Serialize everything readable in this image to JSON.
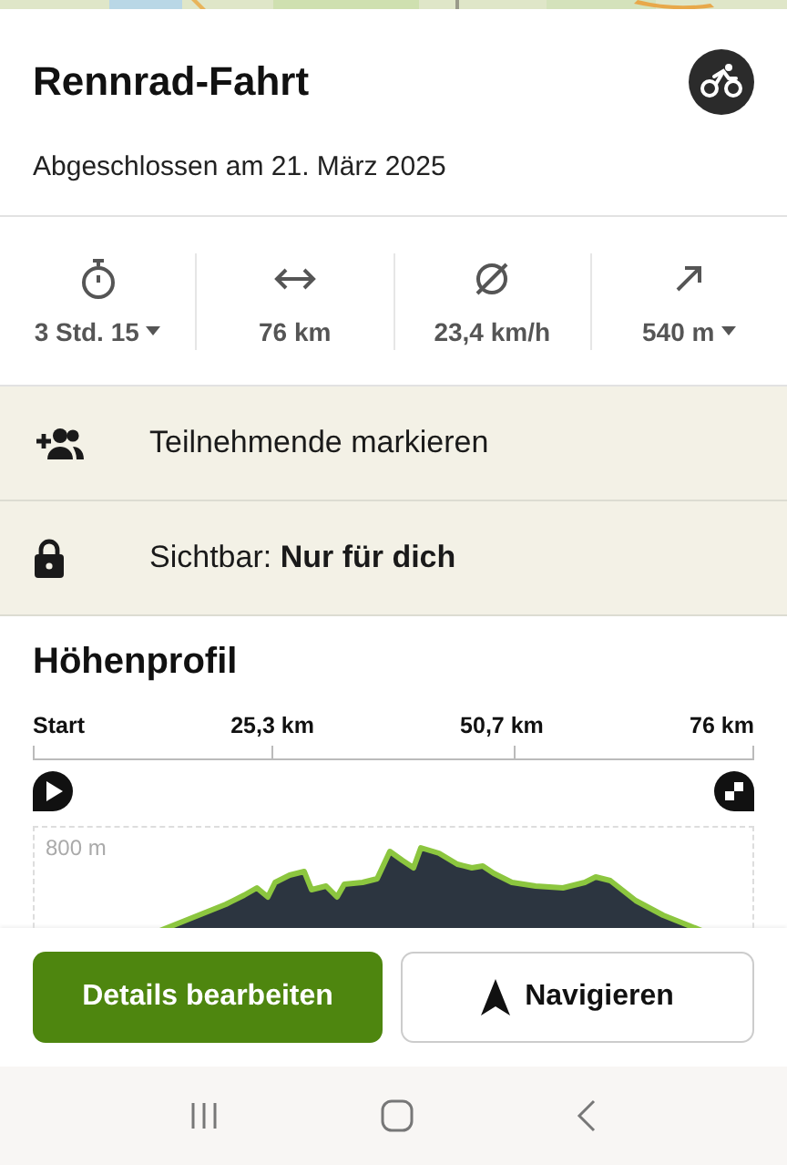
{
  "activity": {
    "title": "Rennrad-Fahrt",
    "subtitle": "Abgeschlossen am 21. März 2025"
  },
  "stats": [
    {
      "kind": "duration",
      "value": "3 Std. 15",
      "dropdown": true
    },
    {
      "kind": "distance",
      "value": "76 km",
      "dropdown": false
    },
    {
      "kind": "speed",
      "value": "23,4 km/h",
      "dropdown": false
    },
    {
      "kind": "ascent",
      "value": "540 m",
      "dropdown": true
    }
  ],
  "actions": [
    {
      "kind": "people",
      "label": "Teilnehmende markieren"
    },
    {
      "kind": "lock",
      "label": "Sichtbar: **Nur für dich**"
    }
  ],
  "elevation": {
    "title": "Höhenprofil",
    "distance_labels": [
      "Start",
      "25,3 km",
      "50,7 km",
      "76 km"
    ],
    "height_label": "800 m"
  },
  "buttons": [
    {
      "kind": "primary",
      "label": "Details bearbeiten"
    },
    {
      "kind": "navigate",
      "label": "Navigieren"
    }
  ]
}
